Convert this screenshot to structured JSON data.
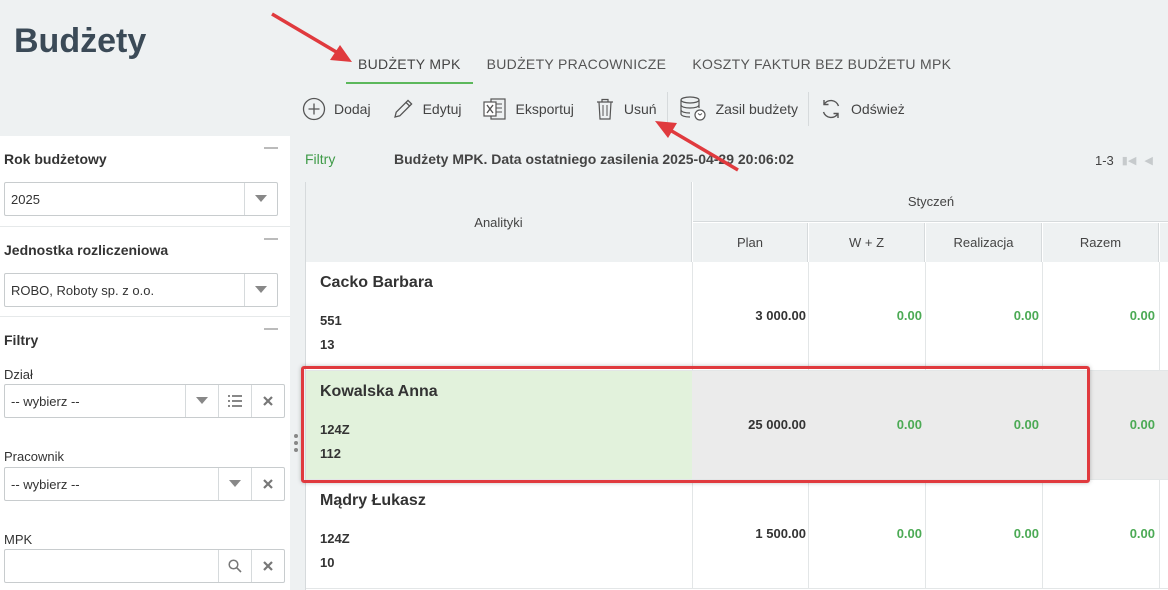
{
  "page": {
    "title": "Budżety"
  },
  "tabs": [
    {
      "label": "BUDŻETY MPK",
      "active": true
    },
    {
      "label": "BUDŻETY PRACOWNICZE",
      "active": false
    },
    {
      "label": "KOSZTY FAKTUR BEZ BUDŻETU MPK",
      "active": false
    }
  ],
  "toolbar": {
    "add": "Dodaj",
    "edit": "Edytuj",
    "export": "Eksportuj",
    "delete": "Usuń",
    "fund": "Zasil budżety",
    "refresh": "Odśwież"
  },
  "sidebar": {
    "year_label": "Rok budżetowy",
    "year_value": "2025",
    "unit_label": "Jednostka rozliczeniowa",
    "unit_value": "ROBO, Roboty sp. z o.o.",
    "filters_label": "Filtry",
    "dept_label": "Dział",
    "dept_value": "-- wybierz --",
    "employee_label": "Pracownik",
    "employee_value": "-- wybierz --",
    "mpk_label": "MPK",
    "mpk_value": ""
  },
  "grid": {
    "filters_link": "Filtry",
    "caption": "Budżety MPK. Data ostatniego zasilenia 2025-04-29 20:06:02",
    "pager": "1-3",
    "headers": {
      "analytics": "Analityki",
      "month": "Styczeń",
      "plan": "Plan",
      "wz": "W + Z",
      "realization": "Realizacja",
      "total": "Razem"
    },
    "rows": [
      {
        "name": "Cacko Barbara",
        "code1": "551",
        "code2": "13",
        "plan": "3 000.00",
        "wz": "0.00",
        "realization": "0.00",
        "total": "0.00",
        "selected": false
      },
      {
        "name": "Kowalska Anna",
        "code1": "124Z",
        "code2": "112",
        "plan": "25 000.00",
        "wz": "0.00",
        "realization": "0.00",
        "total": "0.00",
        "selected": true
      },
      {
        "name": "Mądry Łukasz",
        "code1": "124Z",
        "code2": "10",
        "plan": "1 500.00",
        "wz": "0.00",
        "realization": "0.00",
        "total": "0.00",
        "selected": false
      }
    ]
  },
  "colors": {
    "accent_green": "#5cb85c",
    "value_green": "#4caa55",
    "selected_row": "#e2f2dc",
    "annotation_red": "#e03a3e"
  }
}
